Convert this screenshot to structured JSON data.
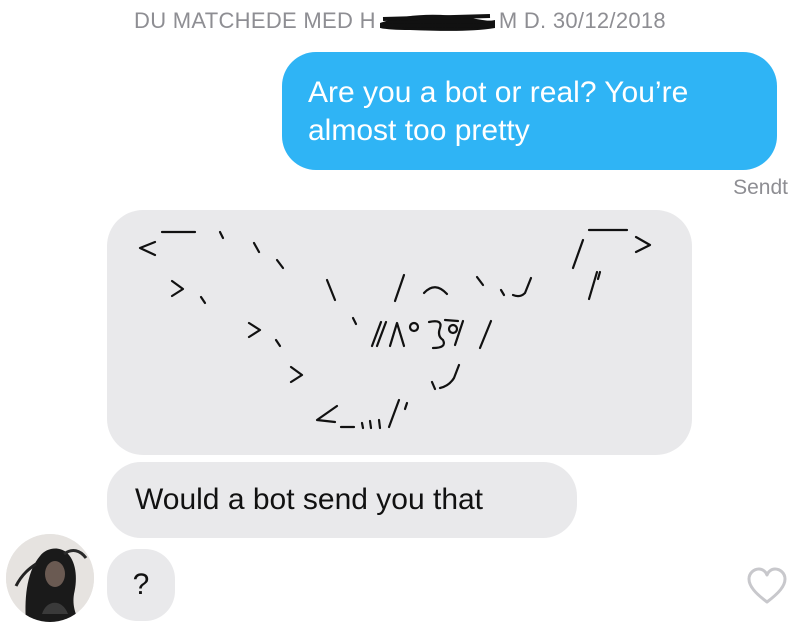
{
  "header": {
    "match_prefix": "DU MATCHEDE MED H",
    "match_suffix": "M D. 30/12/2018"
  },
  "messages": {
    "outgoing_1": "Are you a bot or real? You’re almost too pretty",
    "sent_status": "Sendt",
    "incoming_art": "<—`、 、 ﹨ /⌒ヽ,ノ /¯> 」、 ﹨ /⌒ヽ,ノ /' 」、 `//\\°ʖ̯°/ / > ,ノ ∠_,,,/´",
    "incoming_2": "Would a bot send you that",
    "incoming_3": "?"
  },
  "colors": {
    "outgoing_bubble": "#2fb4f5",
    "incoming_bubble": "#e9e9eb",
    "muted_text": "#8e8e93"
  },
  "icons": {
    "like": "heart-outline-icon",
    "avatar": "profile-photo"
  }
}
